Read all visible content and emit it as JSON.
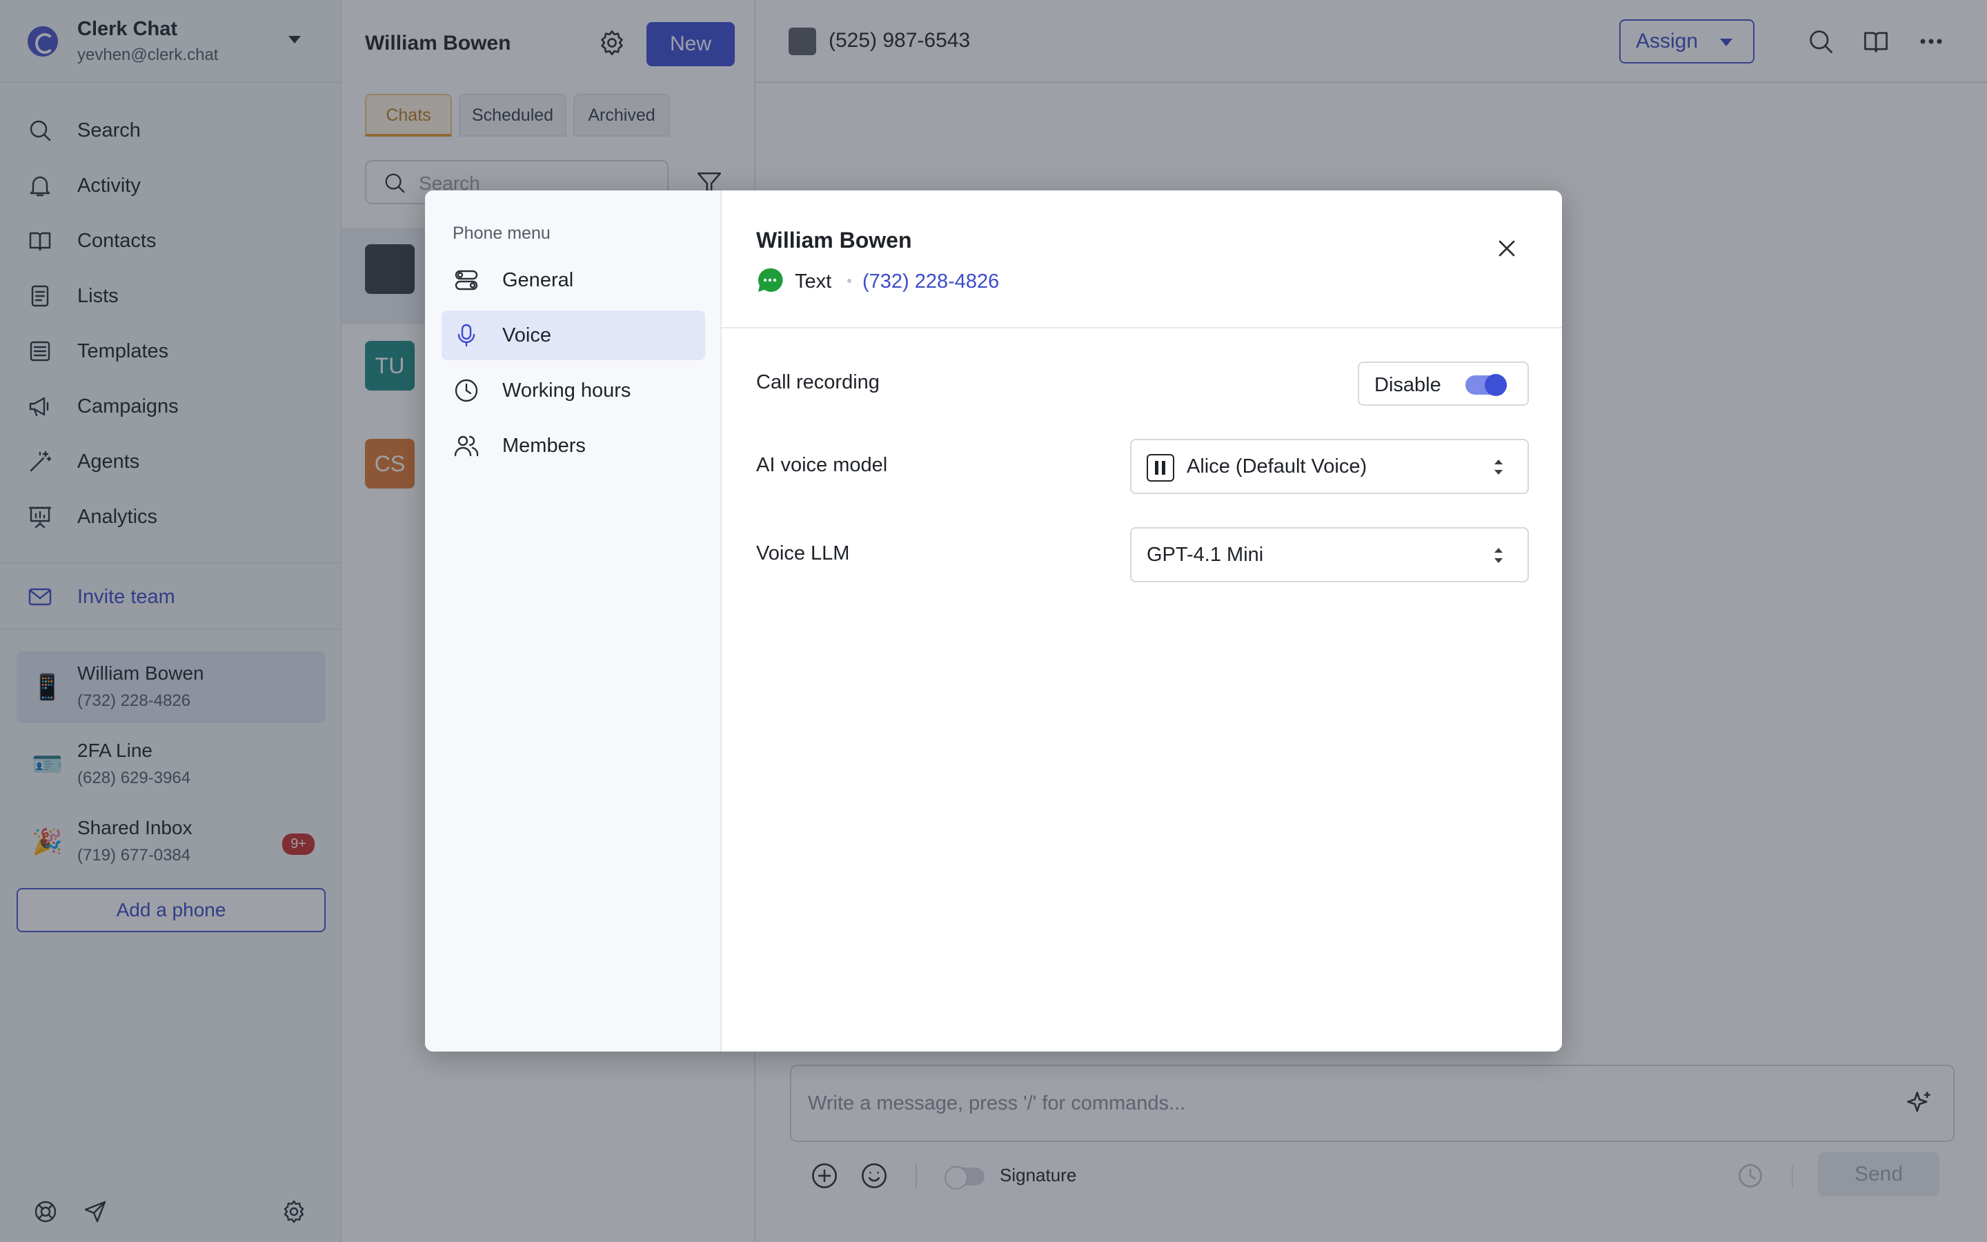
{
  "workspace": {
    "name": "Clerk Chat",
    "email": "yevhen@clerk.chat"
  },
  "nav": [
    {
      "label": "Search",
      "icon": "search-icon"
    },
    {
      "label": "Activity",
      "icon": "bell-icon"
    },
    {
      "label": "Contacts",
      "icon": "book-icon"
    },
    {
      "label": "Lists",
      "icon": "list-icon"
    },
    {
      "label": "Templates",
      "icon": "template-icon"
    },
    {
      "label": "Campaigns",
      "icon": "megaphone-icon"
    },
    {
      "label": "Agents",
      "icon": "wand-icon"
    },
    {
      "label": "Analytics",
      "icon": "presentation-icon"
    }
  ],
  "invite": {
    "label": "Invite team"
  },
  "phones": [
    {
      "name": "William Bowen",
      "number": "(732) 228-4826",
      "emoji": "📱"
    },
    {
      "name": "2FA Line",
      "number": "(628) 629-3964",
      "emoji": "🪪"
    },
    {
      "name": "Shared Inbox",
      "number": "(719) 677-0384",
      "emoji": "🎉",
      "badge": "9+"
    }
  ],
  "add_phone": "Add a phone",
  "chat_list": {
    "title": "William Bowen",
    "new_label": "New",
    "tabs": [
      "Chats",
      "Scheduled",
      "Archived"
    ],
    "search_placeholder": "Search",
    "rows": [
      {
        "initials": "",
        "color": "#3a3d42"
      },
      {
        "initials": "TU",
        "color": "#1f8c86"
      },
      {
        "initials": "CS",
        "color": "#e07a33"
      }
    ]
  },
  "conversation": {
    "number": "(525) 987-6543",
    "assign_label": "Assign",
    "composer_placeholder": "Write a message, press '/' for commands...",
    "signature_label": "Signature",
    "send_label": "Send"
  },
  "modal": {
    "menu_caption": "Phone menu",
    "menu": [
      {
        "label": "General",
        "icon": "toggles-icon"
      },
      {
        "label": "Voice",
        "icon": "microphone-icon"
      },
      {
        "label": "Working hours",
        "icon": "clock-icon"
      },
      {
        "label": "Members",
        "icon": "users-icon"
      }
    ],
    "active_menu": "Voice",
    "contact_name": "William Bowen",
    "channel": "Text",
    "channel_number": "(732) 228-4826",
    "call_recording_label": "Call recording",
    "call_recording_toggle_label": "Disable",
    "call_recording_enabled": true,
    "ai_voice_model_label": "AI voice model",
    "ai_voice_model_value": "Alice (Default Voice)",
    "voice_llm_label": "Voice LLM",
    "voice_llm_value": "GPT-4.1 Mini"
  },
  "colors": {
    "accent": "#3d4fd6",
    "badge": "#c93131",
    "tab_active": "#e8992f",
    "text_channel": "#1f9d3a"
  }
}
